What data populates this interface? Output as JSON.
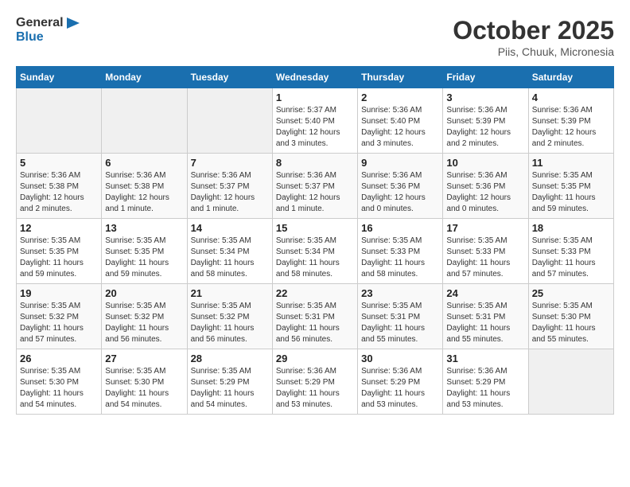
{
  "logo": {
    "line1": "General",
    "line2": "Blue"
  },
  "title": "October 2025",
  "location": "Piis, Chuuk, Micronesia",
  "days_of_week": [
    "Sunday",
    "Monday",
    "Tuesday",
    "Wednesday",
    "Thursday",
    "Friday",
    "Saturday"
  ],
  "weeks": [
    [
      {
        "day": "",
        "info": ""
      },
      {
        "day": "",
        "info": ""
      },
      {
        "day": "",
        "info": ""
      },
      {
        "day": "1",
        "info": "Sunrise: 5:37 AM\nSunset: 5:40 PM\nDaylight: 12 hours and 3 minutes."
      },
      {
        "day": "2",
        "info": "Sunrise: 5:36 AM\nSunset: 5:40 PM\nDaylight: 12 hours and 3 minutes."
      },
      {
        "day": "3",
        "info": "Sunrise: 5:36 AM\nSunset: 5:39 PM\nDaylight: 12 hours and 2 minutes."
      },
      {
        "day": "4",
        "info": "Sunrise: 5:36 AM\nSunset: 5:39 PM\nDaylight: 12 hours and 2 minutes."
      }
    ],
    [
      {
        "day": "5",
        "info": "Sunrise: 5:36 AM\nSunset: 5:38 PM\nDaylight: 12 hours and 2 minutes."
      },
      {
        "day": "6",
        "info": "Sunrise: 5:36 AM\nSunset: 5:38 PM\nDaylight: 12 hours and 1 minute."
      },
      {
        "day": "7",
        "info": "Sunrise: 5:36 AM\nSunset: 5:37 PM\nDaylight: 12 hours and 1 minute."
      },
      {
        "day": "8",
        "info": "Sunrise: 5:36 AM\nSunset: 5:37 PM\nDaylight: 12 hours and 1 minute."
      },
      {
        "day": "9",
        "info": "Sunrise: 5:36 AM\nSunset: 5:36 PM\nDaylight: 12 hours and 0 minutes."
      },
      {
        "day": "10",
        "info": "Sunrise: 5:36 AM\nSunset: 5:36 PM\nDaylight: 12 hours and 0 minutes."
      },
      {
        "day": "11",
        "info": "Sunrise: 5:35 AM\nSunset: 5:35 PM\nDaylight: 11 hours and 59 minutes."
      }
    ],
    [
      {
        "day": "12",
        "info": "Sunrise: 5:35 AM\nSunset: 5:35 PM\nDaylight: 11 hours and 59 minutes."
      },
      {
        "day": "13",
        "info": "Sunrise: 5:35 AM\nSunset: 5:35 PM\nDaylight: 11 hours and 59 minutes."
      },
      {
        "day": "14",
        "info": "Sunrise: 5:35 AM\nSunset: 5:34 PM\nDaylight: 11 hours and 58 minutes."
      },
      {
        "day": "15",
        "info": "Sunrise: 5:35 AM\nSunset: 5:34 PM\nDaylight: 11 hours and 58 minutes."
      },
      {
        "day": "16",
        "info": "Sunrise: 5:35 AM\nSunset: 5:33 PM\nDaylight: 11 hours and 58 minutes."
      },
      {
        "day": "17",
        "info": "Sunrise: 5:35 AM\nSunset: 5:33 PM\nDaylight: 11 hours and 57 minutes."
      },
      {
        "day": "18",
        "info": "Sunrise: 5:35 AM\nSunset: 5:33 PM\nDaylight: 11 hours and 57 minutes."
      }
    ],
    [
      {
        "day": "19",
        "info": "Sunrise: 5:35 AM\nSunset: 5:32 PM\nDaylight: 11 hours and 57 minutes."
      },
      {
        "day": "20",
        "info": "Sunrise: 5:35 AM\nSunset: 5:32 PM\nDaylight: 11 hours and 56 minutes."
      },
      {
        "day": "21",
        "info": "Sunrise: 5:35 AM\nSunset: 5:32 PM\nDaylight: 11 hours and 56 minutes."
      },
      {
        "day": "22",
        "info": "Sunrise: 5:35 AM\nSunset: 5:31 PM\nDaylight: 11 hours and 56 minutes."
      },
      {
        "day": "23",
        "info": "Sunrise: 5:35 AM\nSunset: 5:31 PM\nDaylight: 11 hours and 55 minutes."
      },
      {
        "day": "24",
        "info": "Sunrise: 5:35 AM\nSunset: 5:31 PM\nDaylight: 11 hours and 55 minutes."
      },
      {
        "day": "25",
        "info": "Sunrise: 5:35 AM\nSunset: 5:30 PM\nDaylight: 11 hours and 55 minutes."
      }
    ],
    [
      {
        "day": "26",
        "info": "Sunrise: 5:35 AM\nSunset: 5:30 PM\nDaylight: 11 hours and 54 minutes."
      },
      {
        "day": "27",
        "info": "Sunrise: 5:35 AM\nSunset: 5:30 PM\nDaylight: 11 hours and 54 minutes."
      },
      {
        "day": "28",
        "info": "Sunrise: 5:35 AM\nSunset: 5:29 PM\nDaylight: 11 hours and 54 minutes."
      },
      {
        "day": "29",
        "info": "Sunrise: 5:36 AM\nSunset: 5:29 PM\nDaylight: 11 hours and 53 minutes."
      },
      {
        "day": "30",
        "info": "Sunrise: 5:36 AM\nSunset: 5:29 PM\nDaylight: 11 hours and 53 minutes."
      },
      {
        "day": "31",
        "info": "Sunrise: 5:36 AM\nSunset: 5:29 PM\nDaylight: 11 hours and 53 minutes."
      },
      {
        "day": "",
        "info": ""
      }
    ]
  ]
}
